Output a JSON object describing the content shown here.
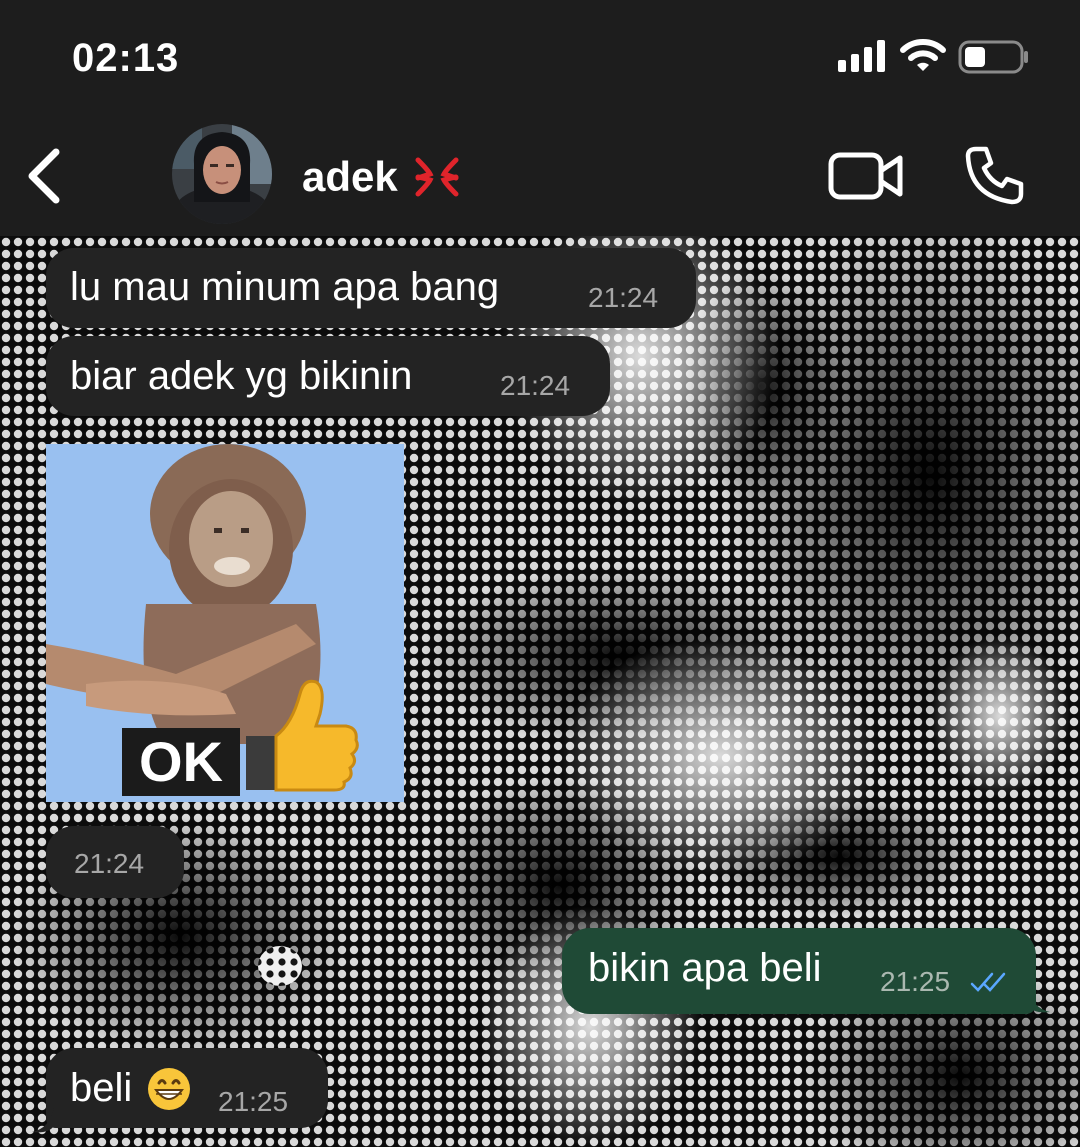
{
  "status_bar": {
    "time": "02:13"
  },
  "header": {
    "contact_name": "adek",
    "name_emoji": "anger-symbol-icon",
    "buttons": [
      "back",
      "video-call",
      "voice-call"
    ]
  },
  "messages": [
    {
      "direction": "in",
      "text": "lu mau minum apa bang",
      "time": "21:24"
    },
    {
      "direction": "in",
      "text": "biar adek yg bikinin",
      "time": "21:24"
    },
    {
      "direction": "in",
      "type": "sticker",
      "sticker_text": "OK",
      "sticker_emoji": "thumbs-up",
      "time": "21:24"
    },
    {
      "direction": "out",
      "text": "bikin apa beli",
      "time": "21:25",
      "status": "read"
    },
    {
      "direction": "in",
      "text": "beli",
      "emoji": "grinning-face",
      "time": "21:25"
    }
  ],
  "colors": {
    "header_bg": "#1d1d1d",
    "incoming_bubble": "#232323",
    "outgoing_bubble": "#1f4a36",
    "read_tick": "#5aa7ff",
    "anger_red": "#e0242b"
  }
}
